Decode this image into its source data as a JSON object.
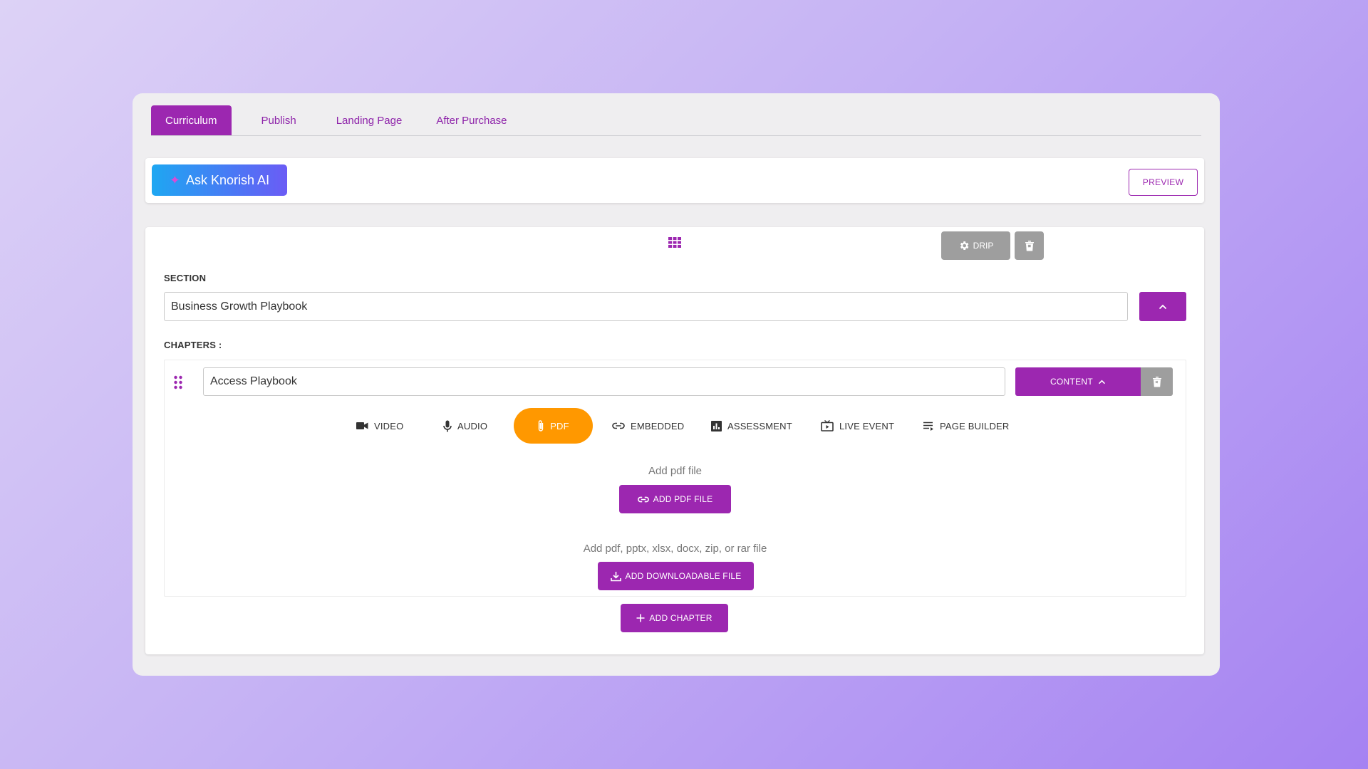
{
  "tabs": [
    {
      "label": "Curriculum",
      "active": true
    },
    {
      "label": "Publish",
      "active": false
    },
    {
      "label": "Landing Page",
      "active": false
    },
    {
      "label": "After Purchase",
      "active": false
    }
  ],
  "ai_bar": {
    "ask_ai_label": "Ask Knorish AI",
    "preview_label": "PREVIEW"
  },
  "section": {
    "drip_label": "DRIP",
    "section_label": "SECTION",
    "section_value": "Business Growth Playbook",
    "chapters_label": "CHAPTERS :"
  },
  "chapter": {
    "title_value": "Access Playbook",
    "content_label": "CONTENT",
    "content_types": [
      {
        "label": "VIDEO",
        "icon": "video-icon",
        "active": false
      },
      {
        "label": "AUDIO",
        "icon": "mic-icon",
        "active": false
      },
      {
        "label": "PDF",
        "icon": "paperclip-icon",
        "active": true
      },
      {
        "label": "EMBEDDED",
        "icon": "link-icon",
        "active": false
      },
      {
        "label": "ASSESSMENT",
        "icon": "chart-icon",
        "active": false
      },
      {
        "label": "LIVE EVENT",
        "icon": "live-tv-icon",
        "active": false
      },
      {
        "label": "PAGE BUILDER",
        "icon": "list-icon",
        "active": false
      }
    ],
    "pdf_hint": "Add pdf file",
    "add_pdf_label": "ADD PDF FILE",
    "download_hint": "Add pdf, pptx, xlsx, docx, zip, or rar file",
    "add_download_label": "ADD DOWNLOADABLE FILE"
  },
  "add_chapter_label": "ADD CHAPTER",
  "colors": {
    "primary": "#9c27b0",
    "active_type": "#ff9800",
    "grey_button": "#9e9e9e"
  }
}
